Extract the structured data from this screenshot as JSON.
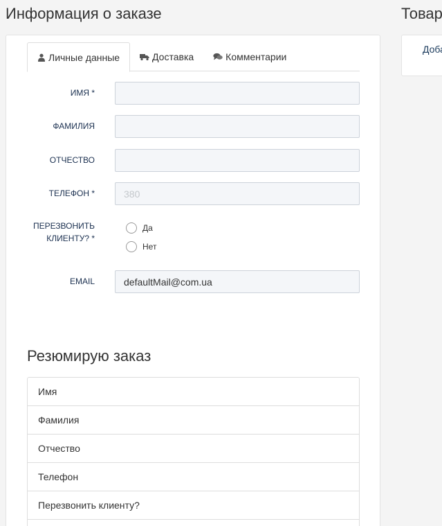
{
  "page": {
    "title": "Информация о заказе"
  },
  "side": {
    "title": "Товар",
    "text": "Доба"
  },
  "tabs": [
    {
      "label": "Личные данные",
      "icon": "user-icon",
      "active": true
    },
    {
      "label": "Доставка",
      "icon": "truck-icon",
      "active": false
    },
    {
      "label": "Комментарии",
      "icon": "comments-icon",
      "active": false
    }
  ],
  "form": {
    "first_name": {
      "label": "ИМЯ *",
      "value": ""
    },
    "last_name": {
      "label": "ФАМИЛИЯ",
      "value": ""
    },
    "middle_name": {
      "label": "ОТЧЕСТВО",
      "value": ""
    },
    "phone": {
      "label": "ТЕЛЕФОН *",
      "placeholder": "380",
      "value": ""
    },
    "callback": {
      "label_line1": "ПЕРЕЗВОНИТЬ",
      "label_line2": "КЛИЕНТУ? *",
      "options": [
        "Да",
        "Нет"
      ]
    },
    "email": {
      "label": "EMAIL",
      "value": "defaultMail@com.ua"
    }
  },
  "summary": {
    "title": "Резюмирую заказ",
    "rows": [
      "Имя",
      "Фамилия",
      "Отчество",
      "Телефон",
      "Перезвонить клиенту?"
    ]
  }
}
